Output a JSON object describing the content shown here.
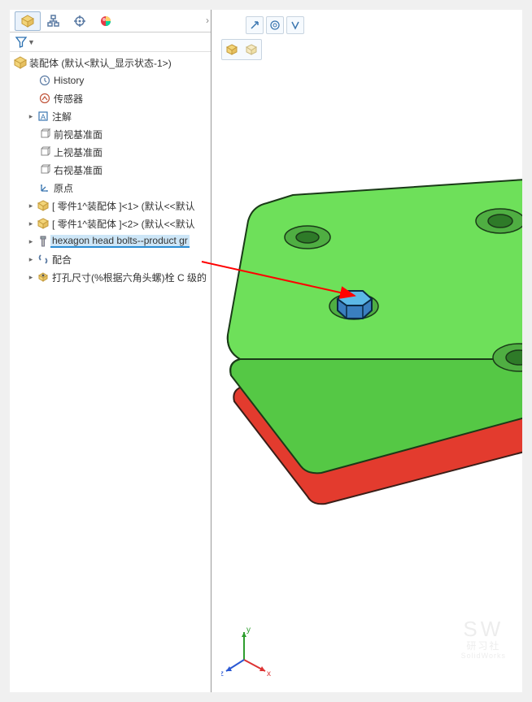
{
  "tabs": {
    "feature_manager": "feature-manager",
    "property_manager": "property-manager",
    "config_manager": "config-manager",
    "display_manager": "display-manager"
  },
  "tree": {
    "root": "装配体 (默认<默认_显示状态-1>)",
    "items": [
      {
        "label": "History",
        "icon": "history-icon"
      },
      {
        "label": "传感器",
        "icon": "sensor-icon"
      },
      {
        "label": "注解",
        "icon": "annotation-icon",
        "expandable": true
      },
      {
        "label": "前视基准面",
        "icon": "plane-icon"
      },
      {
        "label": "上视基准面",
        "icon": "plane-icon"
      },
      {
        "label": "右视基准面",
        "icon": "plane-icon"
      },
      {
        "label": "原点",
        "icon": "origin-icon"
      },
      {
        "label": "[ 零件1^装配体 ]<1> (默认<<默认",
        "icon": "part-icon",
        "expandable": true
      },
      {
        "label": "[ 零件1^装配体 ]<2> (默认<<默认",
        "icon": "part-icon",
        "expandable": true
      },
      {
        "label": "hexagon head bolts--product gr",
        "icon": "bolt-icon",
        "expandable": true,
        "selected": true
      },
      {
        "label": "配合",
        "icon": "mate-icon",
        "expandable": true
      },
      {
        "label": "打孔尺寸(%根据六角头螺)栓 C 级的",
        "icon": "holeset-icon",
        "expandable": true
      }
    ]
  },
  "viewport_toolbar": {
    "arrow": "↗",
    "target": "◎",
    "caliper": "⋏"
  },
  "axis": {
    "x": "x",
    "y": "y",
    "z": "z"
  },
  "watermark": {
    "line1": "SW",
    "line2": "研习社",
    "line3": "SolidWorks"
  }
}
